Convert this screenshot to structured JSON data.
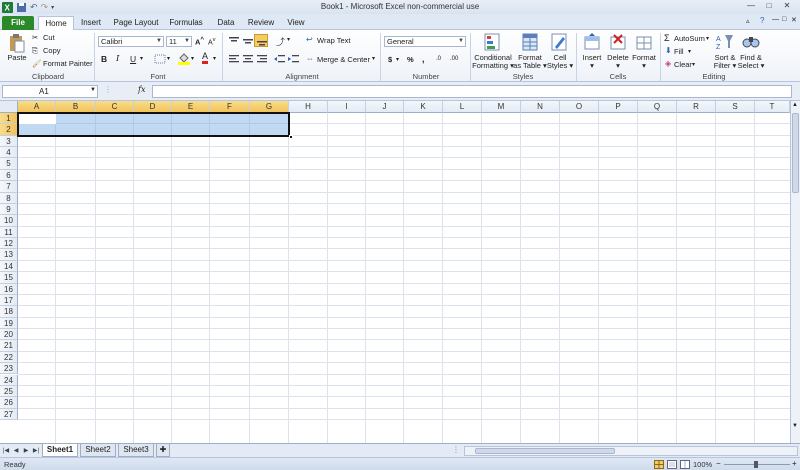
{
  "window": {
    "title": "Book1 - Microsoft Excel non-commercial use",
    "controls": {
      "minimize": "—",
      "maximize": "□",
      "close": "✕"
    }
  },
  "tabs": [
    {
      "label": "File"
    },
    {
      "label": "Home"
    },
    {
      "label": "Insert"
    },
    {
      "label": "Page Layout"
    },
    {
      "label": "Formulas"
    },
    {
      "label": "Data"
    },
    {
      "label": "Review"
    },
    {
      "label": "View"
    }
  ],
  "ribbon": {
    "clipboard": {
      "label": "Clipboard",
      "paste": "Paste",
      "cut": "Cut",
      "copy": "Copy",
      "format_painter": "Format Painter"
    },
    "font": {
      "label": "Font",
      "name": "Calibri",
      "size": "11",
      "bold": "B",
      "italic": "I",
      "underline": "U",
      "grow": "A",
      "shrink": "A",
      "font_color": "A"
    },
    "alignment": {
      "label": "Alignment",
      "wrap_text": "Wrap Text",
      "merge_center": "Merge & Center"
    },
    "number": {
      "label": "Number",
      "format": "General",
      "currency": "$",
      "percent": "%",
      "comma": ",",
      "inc_decimal": ".0",
      "dec_decimal": ".00"
    },
    "styles": {
      "label": "Styles",
      "conditional": [
        "Conditional",
        "Formatting"
      ],
      "format_table": [
        "Format",
        "as Table"
      ],
      "cell_styles": [
        "Cell",
        "Styles"
      ]
    },
    "cells": {
      "label": "Cells",
      "insert": "Insert",
      "delete": "Delete",
      "format": "Format"
    },
    "editing": {
      "label": "Editing",
      "autosum": "AutoSum",
      "fill": "Fill",
      "clear": "Clear",
      "sort_filter": [
        "Sort &",
        "Filter"
      ],
      "find_select": [
        "Find &",
        "Select"
      ]
    }
  },
  "formula_bar": {
    "name_box": "A1",
    "fx": "fx",
    "value": ""
  },
  "columns": [
    "A",
    "B",
    "C",
    "D",
    "E",
    "F",
    "G",
    "H",
    "I",
    "J",
    "K",
    "L",
    "M",
    "N",
    "O",
    "P",
    "Q",
    "R",
    "S",
    "T"
  ],
  "rows": [
    "1",
    "2",
    "3",
    "4",
    "5",
    "6",
    "7",
    "8",
    "9",
    "10",
    "11",
    "12",
    "13",
    "14",
    "15",
    "16",
    "17",
    "18",
    "19",
    "20",
    "21",
    "22",
    "23",
    "24",
    "25",
    "26",
    "27"
  ],
  "selection": {
    "range": "A1:G2",
    "active_cell": "A1"
  },
  "sheets": [
    {
      "label": "Sheet1",
      "active": true
    },
    {
      "label": "Sheet2"
    },
    {
      "label": "Sheet3"
    }
  ],
  "status": {
    "text": "Ready",
    "zoom": "100%"
  }
}
